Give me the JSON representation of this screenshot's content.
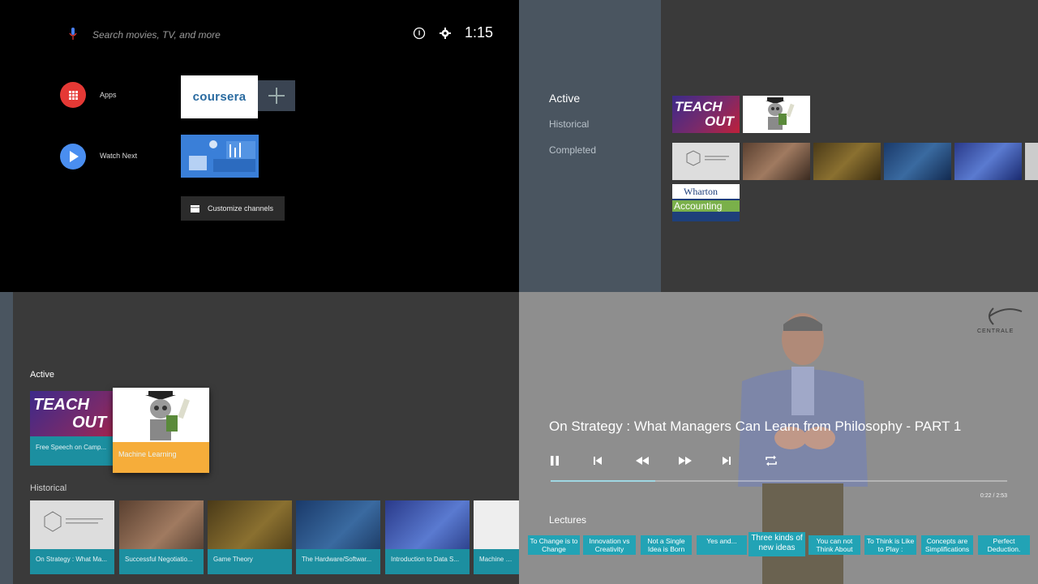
{
  "home": {
    "search_placeholder": "Search movies, TV, and more",
    "clock": "1:15",
    "apps_label": "Apps",
    "watch_next_label": "Watch Next",
    "coursera_label": "coursera",
    "customize_label": "Customize channels"
  },
  "browse_top": {
    "nav": [
      "Active",
      "Historical",
      "Completed"
    ],
    "teach_out_text": [
      "TEACH",
      "OUT"
    ],
    "wharton_text": "Wharton",
    "accounting_text": "Accounting"
  },
  "browse_bottom": {
    "active_label": "Active",
    "historical_label": "Historical",
    "active_cards": [
      "Free Speech on Camp...",
      "Machine Learning"
    ],
    "historical_cards": [
      "On Strategy : What Ma...",
      "Successful Negotiatio...",
      "Game Theory",
      "The Hardware/Softwar...",
      "Introduction to Data S...",
      "Machine Lea..."
    ]
  },
  "player": {
    "title": "On Strategy : What Managers Can Learn from Philosophy - PART 1",
    "time": "0:22  /  2:53",
    "progress": 0.23,
    "lectures_label": "Lectures",
    "logo_text": "CENTRALE",
    "lectures": [
      "To Change is to Change",
      "Innovation vs Creativity",
      "Not a Single Idea is Born",
      "Yes and...",
      "Three kinds of new ideas",
      "You can not Think About",
      "To Think is Like to Play :",
      "Concepts are Simplifications",
      "Perfect Deduction."
    ]
  },
  "colors": {
    "accent": "#1c8fa0",
    "apps_red": "#e53935",
    "watch_blue": "#4a8ef0"
  }
}
